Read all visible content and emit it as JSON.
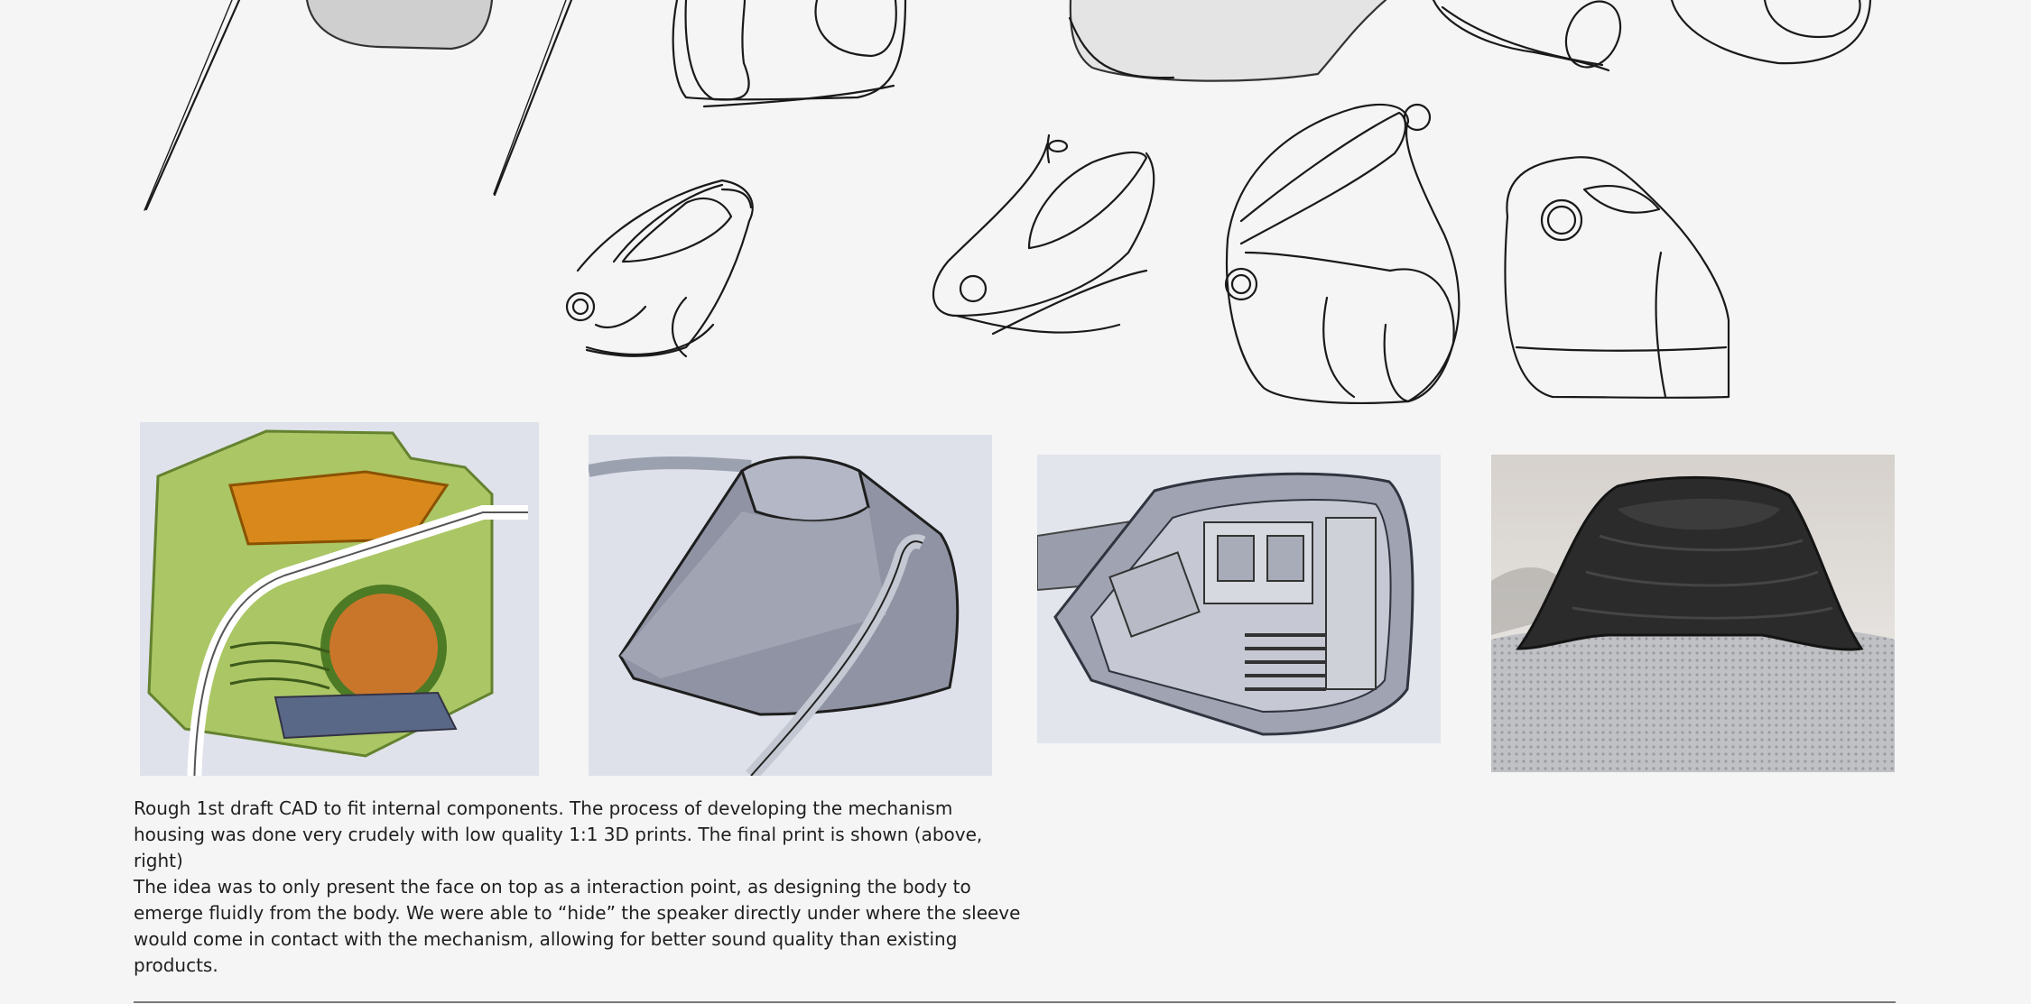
{
  "captions": {
    "cad_note": "Rough 1st draft CAD to fit internal components. The process of developing the mechanism housing was done very crudely with low quality 1:1 3D prints. The final print is shown (above, right)",
    "design_note": "The idea was to only present the face on top as a interaction point, as designing the body to emerge fluidly from the body. We were able to “hide” the speaker directly under where the sleeve would come in contact with the mechanism, allowing for better sound quality than existing products."
  },
  "colors": {
    "background": "#f5f5f5",
    "sketch_stroke": "#1a1a1a",
    "cad_green": "#8fb33a",
    "cad_orange": "#d9891c",
    "cad_grey": "#9ea3b2",
    "print_black": "#2a2a2a",
    "fabric_grey": "#b9bbbe",
    "divider": "#7a7a7a"
  }
}
